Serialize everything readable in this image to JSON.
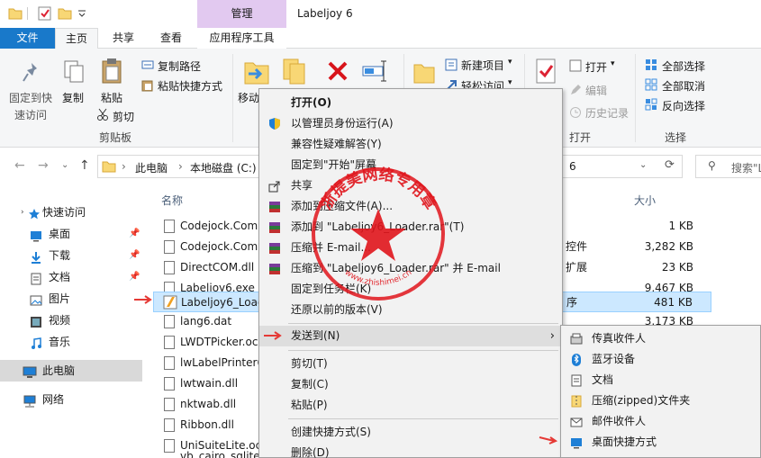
{
  "window": {
    "title": "Labeljoy 6",
    "contextual_tab_group": "管理"
  },
  "ribbon_tabs": {
    "file": "文件",
    "home": "主页",
    "share": "共享",
    "view": "查看",
    "app_tools": "应用程序工具"
  },
  "ribbon": {
    "pin_quick_access": [
      "固定到快",
      "速访问"
    ],
    "copy": "复制",
    "paste": "粘贴",
    "copy_path": "复制路径",
    "paste_shortcut": "粘贴快捷方式",
    "cut": "剪切",
    "clipboard_group": "剪贴板",
    "move_to": "移动",
    "new_item": "新建项目",
    "easy_access": "轻松访问",
    "open": "打开",
    "edit": "编辑",
    "history": "历史记录",
    "open_group": "打开",
    "select_all": "全部选择",
    "select_none": "全部取消",
    "invert_selection": "反向选择",
    "select_group": "选择"
  },
  "address": {
    "crumb_pc": "此电脑",
    "crumb_disk": "本地磁盘 (C:)",
    "crumb_tail": "6",
    "search_placeholder": "搜索\"L"
  },
  "nav": {
    "quick_access": "快速访问",
    "desktop": "桌面",
    "downloads": "下载",
    "documents": "文档",
    "pictures": "图片",
    "videos": "视频",
    "music": "音乐",
    "this_pc": "此电脑",
    "network": "网络"
  },
  "columns": {
    "name": "名称",
    "size": "大小"
  },
  "files": [
    {
      "name": "Codejock.Comm",
      "type": "",
      "size": "1 KB"
    },
    {
      "name": "Codejock.Comm",
      "type": "控件",
      "size": "3,282 KB"
    },
    {
      "name": "DirectCOM.dll",
      "type": "扩展",
      "size": "23 KB"
    },
    {
      "name": "Labeljoy6.exe",
      "type": "",
      "size": "9,467 KB"
    },
    {
      "name": "Labeljoy6_Load",
      "type": "序",
      "size": "481 KB"
    },
    {
      "name": "lang6.dat",
      "type": "",
      "size": "3,173 KB"
    },
    {
      "name": "LWDTPicker.ocx",
      "type": "",
      "size": ""
    },
    {
      "name": "lwLabelPrinter6",
      "type": "",
      "size": ""
    },
    {
      "name": "lwtwain.dll",
      "type": "",
      "size": ""
    },
    {
      "name": "nktwab.dll",
      "type": "",
      "size": ""
    },
    {
      "name": "Ribbon.dll",
      "type": "",
      "size": ""
    },
    {
      "name": "UniSuiteLite.ocx",
      "type": "",
      "size": ""
    },
    {
      "name": "vb_cairo_sqlite.",
      "type": "",
      "size": ""
    }
  ],
  "context_menu": {
    "open": "打开(O)",
    "run_as_admin": "以管理员身份运行(A)",
    "compat_troubleshoot": "兼容性疑难解答(Y)",
    "pin_start": "固定到\"开始\"屏幕",
    "share": "共享",
    "add_archive": "添加到压缩文件(A)...",
    "add_rar": "添加到 \"Labeljoy6_Loader.rar\"(T)",
    "compress_email": "压缩并 E-mail...",
    "compress_rar_email": "压缩到 \"Labeljoy6_Loader.rar\" 并 E-mail",
    "pin_taskbar": "固定到任务栏(K)",
    "restore_versions": "还原以前的版本(V)",
    "send_to": "发送到(N)",
    "cut": "剪切(T)",
    "copy": "复制(C)",
    "paste": "粘贴(P)",
    "create_shortcut": "创建快捷方式(S)",
    "delete": "删除(D)"
  },
  "send_to_menu": {
    "fax": "传真收件人",
    "bluetooth": "蓝牙设备",
    "documents": "文档",
    "zip": "压缩(zipped)文件夹",
    "mail": "邮件收件人",
    "desktop_shortcut": "桌面快捷方式"
  },
  "watermark": {
    "text": "浙提美网络专用章",
    "url": "www.zhishimei.cn"
  },
  "colors": {
    "file_tab": "#1979ca",
    "manage_tab": "#e2c9f0",
    "selection": "#cce8ff",
    "stamp_red": "#e0151c",
    "arrow_red": "#e53935"
  }
}
